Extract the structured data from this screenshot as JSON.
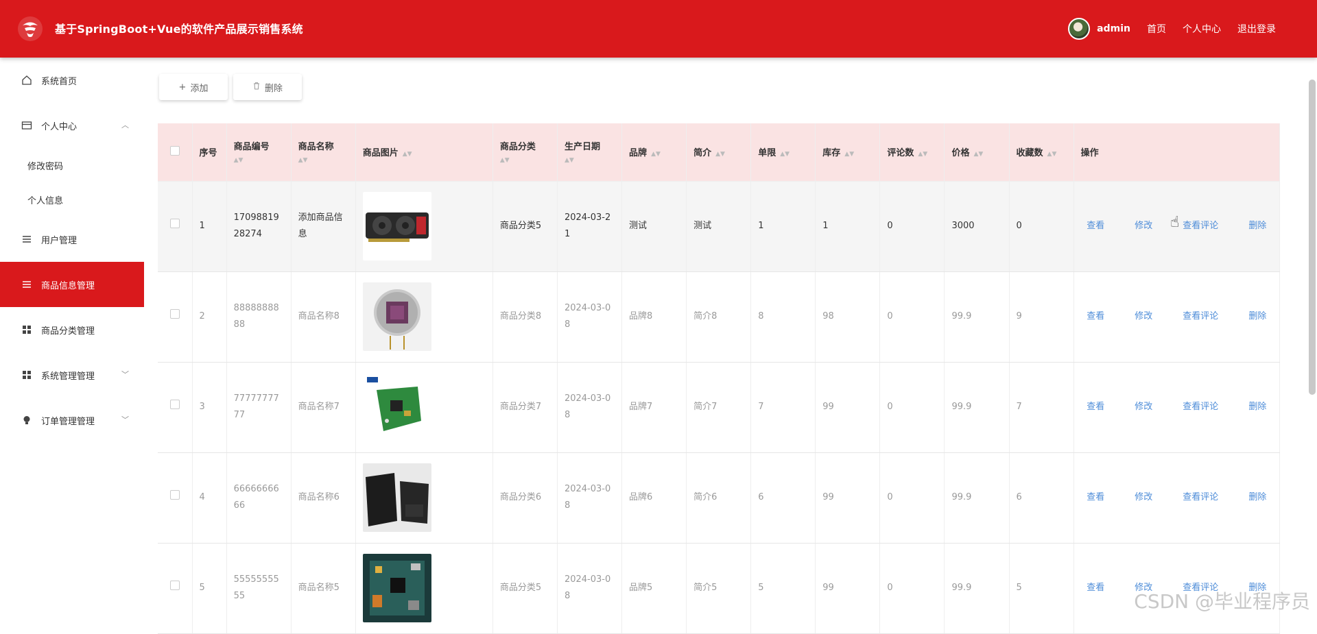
{
  "header": {
    "title": "基于SpringBoot+Vue的软件产品展示销售系统",
    "username": "admin",
    "nav": [
      "首页",
      "个人中心",
      "退出登录"
    ]
  },
  "sidebar": {
    "items": [
      {
        "label": "系统首页",
        "icon": "home-icon"
      },
      {
        "label": "个人中心",
        "icon": "card-icon",
        "expanded": true,
        "children": [
          "修改密码",
          "个人信息"
        ]
      },
      {
        "label": "用户管理",
        "icon": "list-icon"
      },
      {
        "label": "商品信息管理",
        "icon": "list-icon",
        "active": true
      },
      {
        "label": "商品分类管理",
        "icon": "grid-icon"
      },
      {
        "label": "系统管理管理",
        "icon": "grid-icon"
      },
      {
        "label": "订单管理管理",
        "icon": "bulb-icon"
      }
    ]
  },
  "toolbar": {
    "add_label": "添加",
    "delete_label": "删除"
  },
  "table": {
    "headers": [
      "序号",
      "商品编号",
      "商品名称",
      "商品图片",
      "商品分类",
      "生产日期",
      "品牌",
      "简介",
      "单限",
      "库存",
      "评论数",
      "价格",
      "收藏数",
      "操作"
    ],
    "ops": [
      "查看",
      "修改",
      "查看评论",
      "删除"
    ],
    "rows": [
      {
        "idx": "1",
        "code": "1709881928274",
        "name": "添加商品信息",
        "image": "graphics-card",
        "category": "商品分类5",
        "date": "2024-03-21",
        "brand": "测试",
        "intro": "测试",
        "limit": "1",
        "stock": "1",
        "comments": "0",
        "price": "3000",
        "favs": "0"
      },
      {
        "idx": "2",
        "code": "8888888888",
        "name": "商品名称8",
        "image": "sensor-chip",
        "category": "商品分类8",
        "date": "2024-03-08",
        "brand": "品牌8",
        "intro": "简介8",
        "limit": "8",
        "stock": "98",
        "comments": "0",
        "price": "99.9",
        "favs": "9"
      },
      {
        "idx": "3",
        "code": "7777777777",
        "name": "商品名称7",
        "image": "green-pcb",
        "category": "商品分类7",
        "date": "2024-03-08",
        "brand": "品牌7",
        "intro": "简介7",
        "limit": "7",
        "stock": "99",
        "comments": "0",
        "price": "99.9",
        "favs": "7"
      },
      {
        "idx": "4",
        "code": "6666666666",
        "name": "商品名称6",
        "image": "laptops",
        "category": "商品分类6",
        "date": "2024-03-08",
        "brand": "品牌6",
        "intro": "简介6",
        "limit": "6",
        "stock": "99",
        "comments": "0",
        "price": "99.9",
        "favs": "6"
      },
      {
        "idx": "5",
        "code": "5555555555",
        "name": "商品名称5",
        "image": "circuit-board",
        "category": "商品分类5",
        "date": "2024-03-08",
        "brand": "品牌5",
        "intro": "简介5",
        "limit": "5",
        "stock": "99",
        "comments": "0",
        "price": "99.9",
        "favs": "5"
      }
    ]
  },
  "watermark": "CSDN @毕业程序员",
  "colors": {
    "primary": "#d9191c",
    "header_row": "#fae3e3",
    "link": "#4d8cd8"
  }
}
